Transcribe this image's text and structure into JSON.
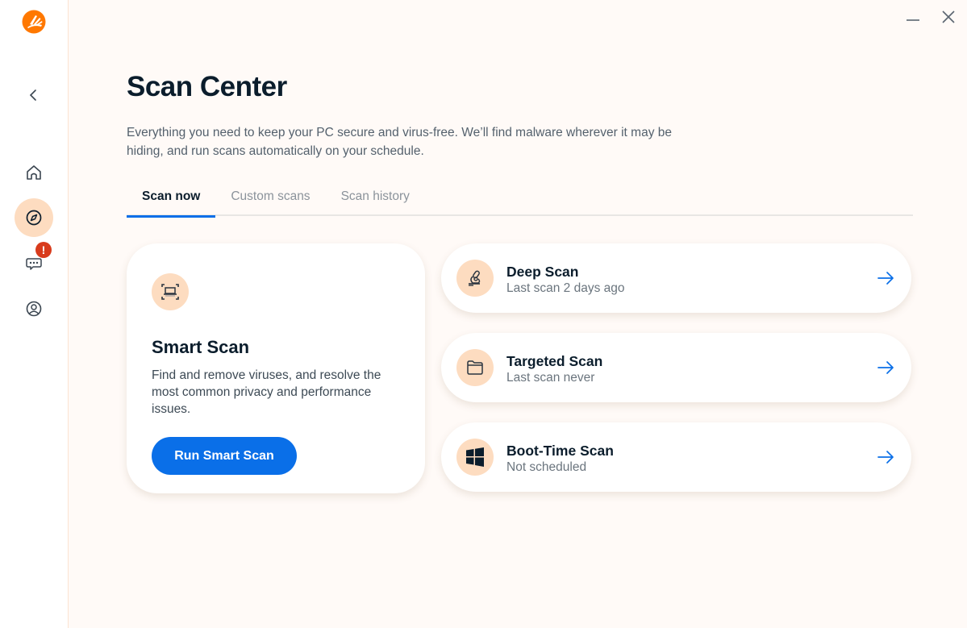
{
  "app": {
    "logo_icon": "avast-logo-icon",
    "brand_color": "#ff7800",
    "accent_color": "#0a6fe8"
  },
  "sidebar": {
    "back_icon": "chevron-left-icon",
    "items": [
      {
        "id": "home",
        "icon": "home-icon",
        "active": false
      },
      {
        "id": "explore",
        "icon": "compass-icon",
        "active": true
      },
      {
        "id": "messages",
        "icon": "chat-icon",
        "active": false,
        "badge": "!"
      },
      {
        "id": "account",
        "icon": "user-icon",
        "active": false
      }
    ]
  },
  "window": {
    "minimize_icon": "minimize-icon",
    "close_icon": "close-icon"
  },
  "header": {
    "title": "Scan Center",
    "subtitle": "Everything you need to keep your PC secure and virus-free. We’ll find malware wherever it may be hiding, and run scans automatically on your schedule."
  },
  "tabs": [
    {
      "label": "Scan now",
      "active": true
    },
    {
      "label": "Custom scans",
      "active": false
    },
    {
      "label": "Scan history",
      "active": false
    }
  ],
  "smart_scan": {
    "icon": "laptop-scan-icon",
    "title": "Smart Scan",
    "description": "Find and remove viruses, and resolve the most common privacy and performance issues.",
    "button_label": "Run Smart Scan"
  },
  "scans": [
    {
      "icon": "microscope-icon",
      "title": "Deep Scan",
      "subtitle": "Last scan 2 days ago"
    },
    {
      "icon": "folder-icon",
      "title": "Targeted Scan",
      "subtitle": "Last scan never"
    },
    {
      "icon": "windows-icon",
      "title": "Boot-Time Scan",
      "subtitle": "Not scheduled"
    }
  ]
}
